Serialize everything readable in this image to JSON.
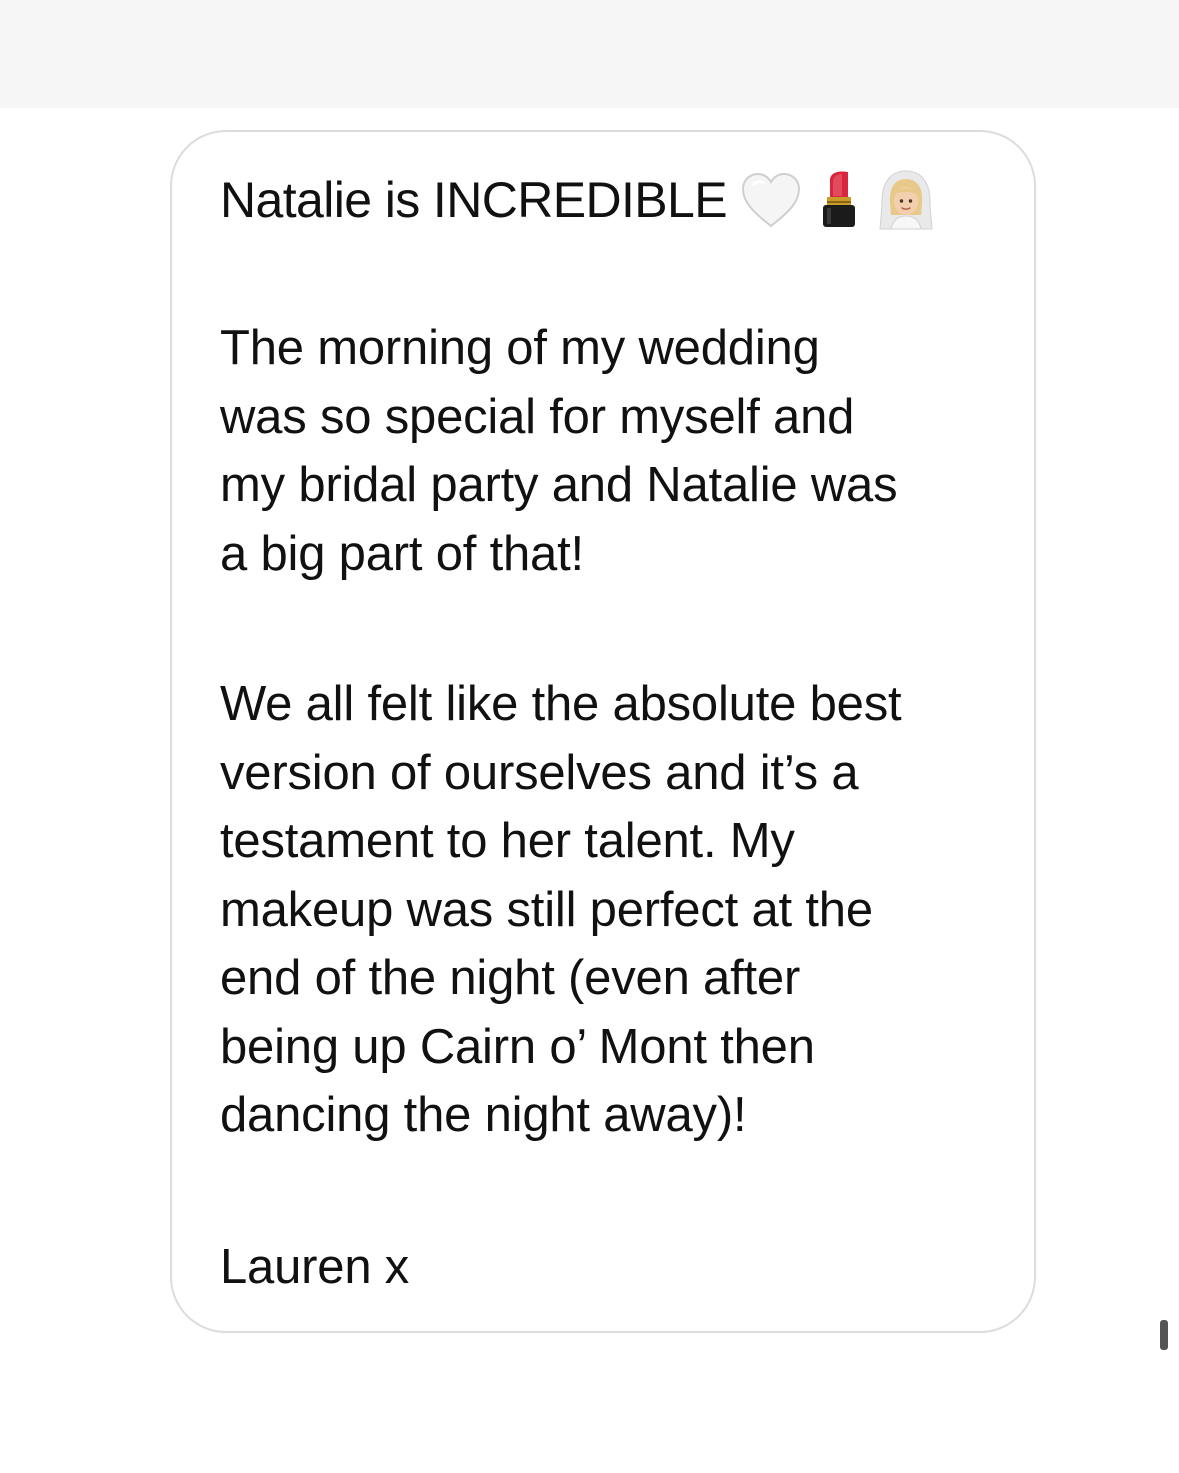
{
  "message": {
    "headline": "Natalie is INCREDIBLE",
    "headline_emojis": [
      "white-heart-icon",
      "lipstick-icon",
      "bride-with-veil-icon"
    ],
    "paragraph_1": [
      "The morning of my wedding",
      "was so special for myself and",
      "my bridal party and Natalie was",
      "a big part of that!"
    ],
    "paragraph_2": [
      "We all felt like the absolute best",
      "version of ourselves and it’s a",
      "testament to her talent. My",
      "makeup was still perfect at the",
      "end of the night (even after",
      "being up Cairn o’ Mont then",
      "dancing the night away)!"
    ],
    "signature": "Lauren x"
  },
  "colors": {
    "text": "#111111",
    "bubble_border": "#dcdcdc",
    "top_band": "#f6f6f6",
    "lipstick": "#d7263d"
  }
}
